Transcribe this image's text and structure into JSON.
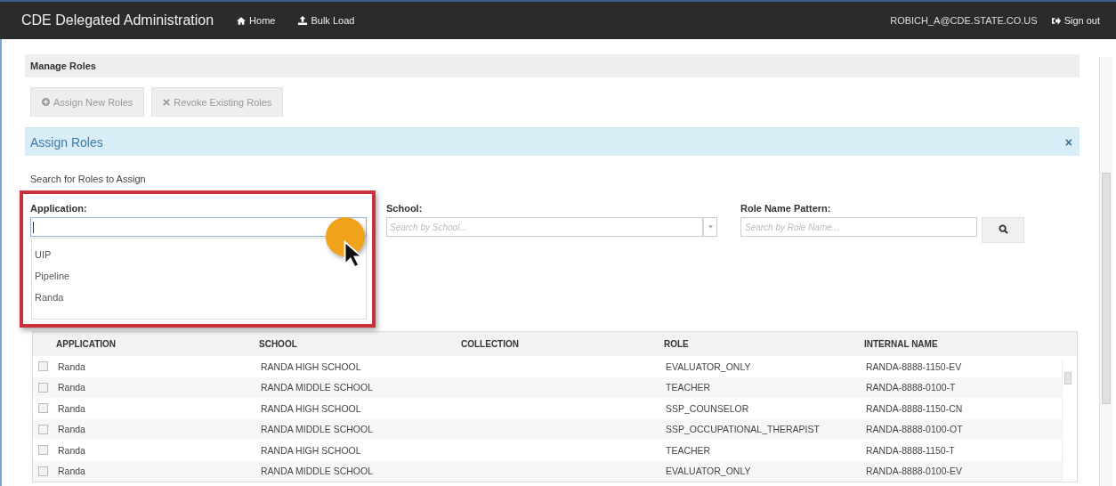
{
  "navbar": {
    "brand": "CDE Delegated Administration",
    "links": [
      {
        "label": "Home"
      },
      {
        "label": "Bulk Load"
      }
    ],
    "user": "ROBICH_A@CDE.STATE.CO.US",
    "sign_out": "Sign out"
  },
  "manage_roles": {
    "title": "Manage Roles",
    "buttons": [
      {
        "label": "Assign New Roles"
      },
      {
        "label": "Revoke Existing Roles"
      }
    ]
  },
  "assign_roles": {
    "title": "Assign Roles",
    "close": "×",
    "search_title": "Search for Roles to Assign",
    "application": {
      "label": "Application:",
      "options": [
        "UIP",
        "Pipeline",
        "Randa"
      ]
    },
    "school": {
      "label": "School:",
      "placeholder": "Search by School..."
    },
    "role_name": {
      "label": "Role Name Pattern:",
      "placeholder": "Search by Role Name..."
    }
  },
  "table": {
    "columns": [
      "APPLICATION",
      "SCHOOL",
      "COLLECTION",
      "ROLE",
      "INTERNAL NAME"
    ],
    "rows": [
      {
        "checked": false,
        "cells": [
          "Randa",
          "RANDA HIGH SCHOOL",
          "",
          "EVALUATOR_ONLY",
          "RANDA-8888-1150-EV"
        ]
      },
      {
        "checked": false,
        "cells": [
          "Randa",
          "RANDA MIDDLE SCHOOL",
          "",
          "TEACHER",
          "RANDA-8888-0100-T"
        ]
      },
      {
        "checked": false,
        "cells": [
          "Randa",
          "RANDA HIGH SCHOOL",
          "",
          "SSP_COUNSELOR",
          "RANDA-8888-1150-CN"
        ]
      },
      {
        "checked": false,
        "cells": [
          "Randa",
          "RANDA MIDDLE SCHOOL",
          "",
          "SSP_OCCUPATIONAL_THERAPIST",
          "RANDA-8888-0100-OT"
        ]
      },
      {
        "checked": false,
        "cells": [
          "Randa",
          "RANDA HIGH SCHOOL",
          "",
          "TEACHER",
          "RANDA-8888-1150-T"
        ]
      },
      {
        "checked": false,
        "cells": [
          "Randa",
          "RANDA MIDDLE SCHOOL",
          "",
          "EVALUATOR_ONLY",
          "RANDA-8888-0100-EV"
        ]
      }
    ]
  }
}
